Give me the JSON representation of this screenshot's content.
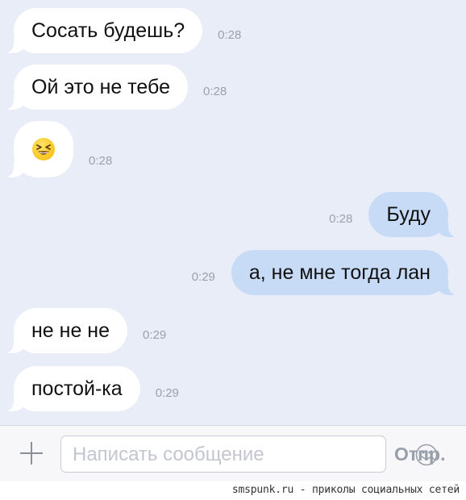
{
  "messages": [
    {
      "direction": "in",
      "text": "Сосать будешь?",
      "time": "0:28"
    },
    {
      "direction": "in",
      "text": "Ой это не тебе",
      "time": "0:28"
    },
    {
      "direction": "in",
      "emoji": "laughing-face-icon",
      "time": "0:28"
    },
    {
      "direction": "out",
      "text": "Буду",
      "time": "0:28"
    },
    {
      "direction": "out",
      "text": "а, не мне тогда лан",
      "time": "0:29"
    },
    {
      "direction": "in",
      "text": "не не не",
      "time": "0:29"
    },
    {
      "direction": "in",
      "text": "постой-ка",
      "time": "0:29"
    }
  ],
  "composer": {
    "placeholder": "Написать сообщение",
    "send_label": "Отпр.",
    "attach_icon": "plus-icon",
    "emoji_icon": "smiley-icon"
  },
  "watermark": "smspunk.ru - приколы социальных сетей",
  "colors": {
    "background": "#e8edf7",
    "incoming_bubble": "#ffffff",
    "outgoing_bubble": "#c7dbf7",
    "timestamp": "#9aa1ad"
  }
}
